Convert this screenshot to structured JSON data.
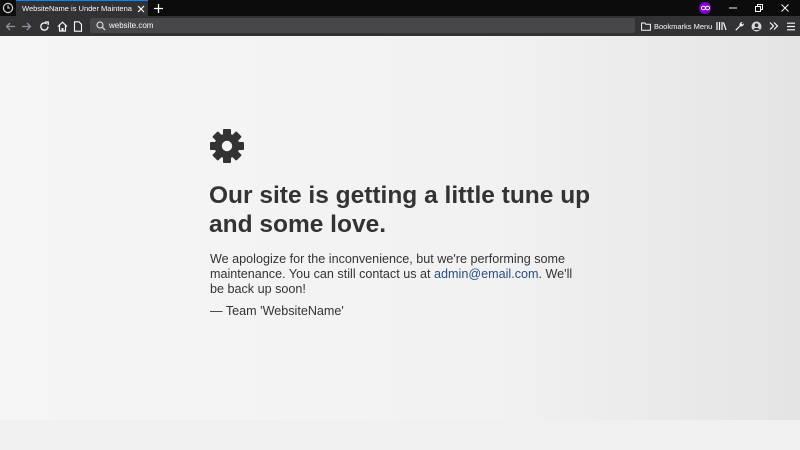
{
  "browser": {
    "tab_title": "WebsiteName is Under Maintenance",
    "url": "website.com",
    "bookmarks_menu_label": "Bookmarks Menu",
    "private_browsing_color": "#8000d7",
    "accent_color": "#0a84ff"
  },
  "icons": {
    "app": "app-icon",
    "tab_close": "close-icon",
    "new_tab": "plus-icon",
    "private": "private-browsing-mask-icon",
    "minimize": "minimize-icon",
    "restore": "restore-icon",
    "close_window": "close-icon",
    "back": "back-arrow-icon",
    "forward": "forward-arrow-icon",
    "reload": "reload-icon",
    "home": "home-icon",
    "url_search": "search-icon",
    "bookmarks": "folder-icon",
    "library": "library-icon",
    "customize": "wrench-icon",
    "account": "account-icon",
    "overflow": "chevron-double-right-icon",
    "menu": "hamburger-menu-icon",
    "page_gear": "gear-icon"
  },
  "page": {
    "headline": "Our site is getting a little tune up and some love.",
    "message_before_link": "We apologize for the inconvenience, but we're performing some maintenance. You can still contact us at ",
    "contact_email": "admin@email.com",
    "message_after_link": ". We'll be back up soon!",
    "signature": "— Team 'WebsiteName'",
    "text_color": "#333333",
    "link_color": "#2a4d80"
  }
}
